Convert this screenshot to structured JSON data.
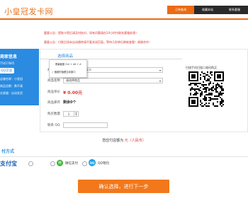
{
  "header": {
    "logo_text": "小皇冠发卡网",
    "nav": [
      {
        "label": "订单查询",
        "active": true
      },
      {
        "label": "收藏本站",
        "active": false
      },
      {
        "label": "联系客服",
        "active": false
      }
    ]
  },
  "notices": [
    "重要公告：提取卡密后请及时核对，如有问题请在24小时内联系客服处理！",
    "重要公告：付款后如未自动跳转请不要关闭页面，等待几秒钟后刷新查看！谢谢合作！"
  ],
  "left_panel": {
    "title": "商家信息",
    "qq_id": "75417845",
    "qq_chat": "QQ交谈",
    "shop_label": "店铺名称：",
    "shop_name": "小皇冠",
    "goods_label": "商品总数：",
    "goods_count": "数不清",
    "trade_label": "交易量：",
    "trade_count": "自动发货"
  },
  "form": {
    "title": "选择商品",
    "category_label": "商品分类",
    "category_value": "小皇冠社区自助发卡",
    "product_label": "商品名称",
    "product_value": "请选择商品",
    "price_label": "商品单价",
    "price_value": "¥ 0.00元",
    "stock_label": "商品库存",
    "stock_value": "剩余0个",
    "qty_label": "购买数量",
    "qty_value": "1",
    "contact_label": "联系 QQ"
  },
  "context_menu": {
    "items": [
      "屏幕截图 Ctrl + Alt + A",
      "截图时隐藏当前窗口"
    ]
  },
  "qr": {
    "caption": "扫描手机扫描二维码购买"
  },
  "summary": {
    "prefix": "您应付总额为",
    "amount": "元（人民币）"
  },
  "payment": {
    "title": "付方式",
    "alipay": "支付宝",
    "wechat_icon": "微",
    "wechat": "微信支付",
    "qq_icon": "QQ",
    "qq": "QQ钱包"
  },
  "submit_label": "确认选择，进行下一步",
  "colors": {
    "accent_orange": "#ec6a13",
    "accent_blue": "#2a8be0",
    "alert_red": "#e0332a"
  }
}
